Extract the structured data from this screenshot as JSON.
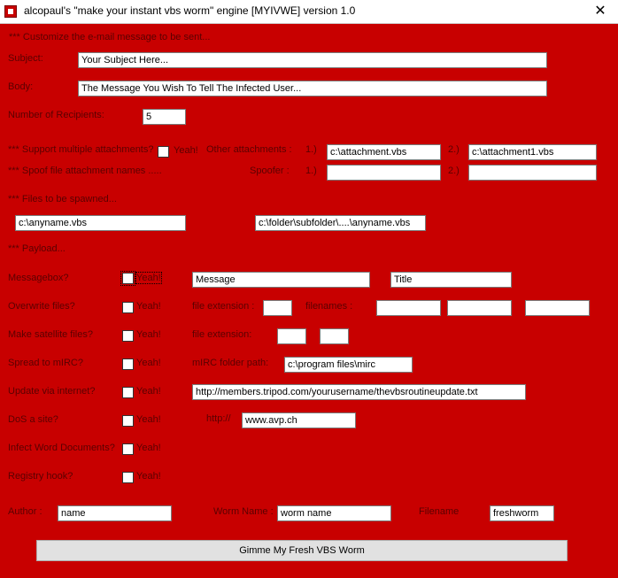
{
  "window": {
    "title": "alcopaul's \"make your instant vbs worm\" engine [MYIVWE] version 1.0",
    "close_glyph": "✕"
  },
  "message": {
    "section_label": "*** Customize the e-mail message to be sent...",
    "subject_label": "Subject:",
    "subject_value": "Your Subject Here...",
    "body_label": "Body:",
    "body_value": "The Message You Wish To Tell The Infected User...",
    "recipients_label": "Number of Recipients:",
    "recipients_value": "5"
  },
  "attachments": {
    "multiple_label": "*** Support multiple attachments?",
    "yeah_label": "Yeah!",
    "other_label": "Other attachments :",
    "slot1_label": "1.)",
    "slot2_label": "2.)",
    "attachment1_value": "c:\\attachment.vbs",
    "attachment2_value": "c:\\attachment1.vbs",
    "spoof_label": "*** Spoof file attachment names .....",
    "spoofer_label": "Spoofer :",
    "spoof1_value": "",
    "spoof2_value": ""
  },
  "spawn": {
    "section_label": "*** Files to be spawned...",
    "file1_value": "c:\\anyname.vbs",
    "file2_value": "c:\\folder\\subfolder\\....\\anyname.vbs"
  },
  "payload": {
    "section_label": "*** Payload...",
    "yeah_label": "Yeah!",
    "messagebox_label": "Messagebox?",
    "messagebox_message": "Message",
    "messagebox_title": "Title",
    "overwrite_label": "Overwrite files?",
    "overwrite_ext_label": "file extension :",
    "overwrite_ext_value": "",
    "overwrite_names_label": "filenames :",
    "overwrite_name1": "",
    "overwrite_name2": "",
    "overwrite_name3": "",
    "satellite_label": "Make satellite files?",
    "satellite_ext_label": "file extension:",
    "satellite_ext1": "",
    "satellite_ext2": "",
    "mirc_label": "Spread to mIRC?",
    "mirc_path_label": "mIRC  folder path:",
    "mirc_path_value": "c:\\program files\\mirc",
    "update_label": "Update via internet?",
    "update_url_value": "http://members.tripod.com/yourusername/thevbsroutineupdate.txt",
    "dos_label": "DoS a site?",
    "dos_prefix_label": "http://",
    "dos_site_value": "www.avp.ch",
    "word_label": "Infect Word Documents?",
    "registry_label": "Registry hook?"
  },
  "author": {
    "author_label": "Author :",
    "author_value": "name",
    "worm_label": "Worm Name :",
    "worm_value": "worm name",
    "filename_label": "Filename",
    "filename_value": "freshworm"
  },
  "actions": {
    "generate_label": "Gimme My Fresh VBS Worm"
  }
}
